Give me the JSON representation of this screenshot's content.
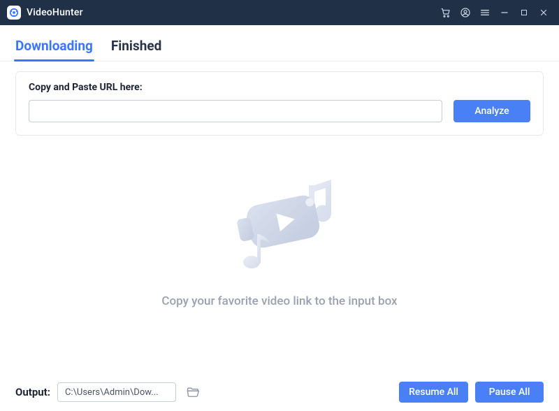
{
  "app": {
    "title": "VideoHunter"
  },
  "tabs": {
    "downloading": "Downloading",
    "finished": "Finished",
    "active": "downloading"
  },
  "urlcard": {
    "label": "Copy and Paste URL here:",
    "value": "",
    "placeholder": "",
    "analyze": "Analyze"
  },
  "empty": {
    "hint": "Copy your favorite video link to the input box"
  },
  "footer": {
    "output_label": "Output:",
    "output_path": "C:\\Users\\Admin\\Dow...",
    "resume_all": "Resume All",
    "pause_all": "Pause All"
  },
  "colors": {
    "accent": "#4a80f6",
    "titlebar": "#203147"
  }
}
